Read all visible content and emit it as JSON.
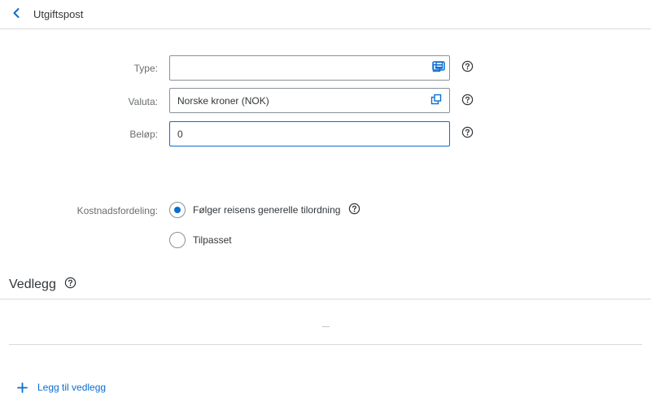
{
  "header": {
    "title": "Utgiftspost",
    "back_icon": "chevron-left-icon"
  },
  "form": {
    "type": {
      "label": "Type:",
      "value": ""
    },
    "currency": {
      "label": "Valuta:",
      "value": "Norske kroner (NOK)"
    },
    "amount": {
      "label": "Beløp:",
      "value": "0"
    }
  },
  "cost_allocation": {
    "label": "Kostnadsfordeling:",
    "options": [
      {
        "label": "Følger reisens generelle tilordning",
        "selected": true
      },
      {
        "label": "Tilpasset",
        "selected": false
      }
    ]
  },
  "attachments": {
    "title": "Vedlegg",
    "add_label": "Legg til vedlegg"
  },
  "colors": {
    "accent": "#0a6ed1",
    "text": "#32363a",
    "label": "#6a6d70",
    "border": "#89919a"
  }
}
